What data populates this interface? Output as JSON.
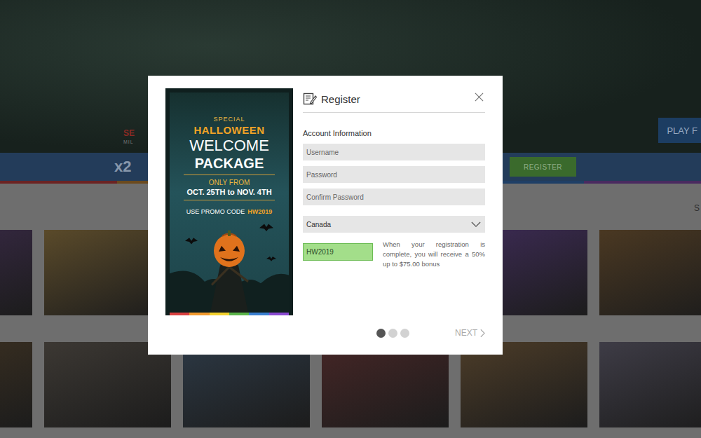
{
  "page": {
    "logo_top": "SE",
    "logo_bottom": "MIL",
    "play_button": "PLAY F",
    "multiplier": "x2",
    "register_button": "REGISTER",
    "search_hint": "S"
  },
  "game_rows": [
    {
      "tiles": [
        {
          "color": "#3a2a48"
        },
        {
          "color": "#5a4a2a"
        },
        {
          "color": "#3a3a3a"
        },
        {
          "color": "#3a3030"
        },
        {
          "color": "#3d2b55"
        },
        {
          "color": "#4a3822"
        }
      ]
    },
    {
      "tiles": [
        {
          "color": "#3e3222"
        },
        {
          "color": "#3c3833"
        },
        {
          "color": "#2c3844"
        },
        {
          "color": "#452626"
        },
        {
          "color": "#4c3c28"
        },
        {
          "color": "#3e3c46"
        }
      ]
    }
  ],
  "dialog": {
    "title": "Register",
    "section": "Account Information",
    "banner": {
      "kicker": "SPECIAL",
      "headline": "HALLOWEEN",
      "line1": "WELCOME",
      "line2": "PACKAGE",
      "dates_label": "ONLY FROM",
      "dates": "OCT. 25TH to NOV. 4TH",
      "code_label": "USE PROMO CODE",
      "code": "HW2019"
    },
    "fields": [
      {
        "placeholder": "Username"
      },
      {
        "placeholder": "Password"
      },
      {
        "placeholder": "Confirm Password"
      }
    ],
    "country": {
      "value": "Canada",
      "expanded": false
    },
    "promo": {
      "value": "HW2019",
      "valid": true
    },
    "promo_note": "When your registration is complete, you will receive a 50% up to $75.00 bonus",
    "steps": [
      {
        "selected": true
      },
      {
        "selected": false
      },
      {
        "selected": false
      }
    ],
    "next_button": "NEXT"
  }
}
